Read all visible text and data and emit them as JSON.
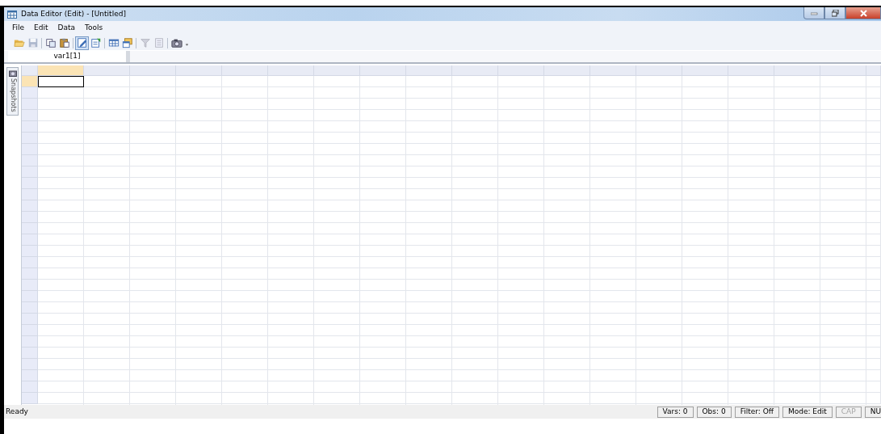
{
  "window": {
    "title": "Data Editor (Edit) - [Untitled]"
  },
  "menu": [
    {
      "label": "File"
    },
    {
      "label": "Edit"
    },
    {
      "label": "Data"
    },
    {
      "label": "Tools"
    }
  ],
  "toolbar": [
    {
      "kind": "open",
      "disabled": false,
      "pressed": false
    },
    {
      "kind": "save",
      "disabled": true,
      "pressed": false
    },
    {
      "kind": "separator"
    },
    {
      "kind": "copy",
      "disabled": false,
      "pressed": false
    },
    {
      "kind": "paste",
      "disabled": false,
      "pressed": false
    },
    {
      "kind": "separator"
    },
    {
      "kind": "edit",
      "disabled": false,
      "pressed": true
    },
    {
      "kind": "browse",
      "disabled": false,
      "pressed": false
    },
    {
      "kind": "separator"
    },
    {
      "kind": "table",
      "disabled": false,
      "pressed": false
    },
    {
      "kind": "properties",
      "disabled": false,
      "pressed": false
    },
    {
      "kind": "separator"
    },
    {
      "kind": "filter",
      "disabled": true,
      "pressed": false
    },
    {
      "kind": "clear",
      "disabled": true,
      "pressed": false
    },
    {
      "kind": "separator"
    },
    {
      "kind": "snapshot",
      "disabled": false,
      "pressed": false
    },
    {
      "kind": "overflow",
      "disabled": false,
      "pressed": false
    }
  ],
  "cell_reference": "var1[1]",
  "side_tab": {
    "label": "Snapshots"
  },
  "grid": {
    "columns": [
      {
        "selected": true
      },
      {
        "selected": false
      },
      {
        "selected": false
      },
      {
        "selected": false
      },
      {
        "selected": false
      },
      {
        "selected": false
      },
      {
        "selected": false
      },
      {
        "selected": false
      },
      {
        "selected": false
      },
      {
        "selected": false
      },
      {
        "selected": false
      },
      {
        "selected": false
      },
      {
        "selected": false
      },
      {
        "selected": false
      },
      {
        "selected": false
      },
      {
        "selected": false
      },
      {
        "selected": false
      },
      {
        "selected": false
      },
      {
        "selected": false
      }
    ],
    "rows": [
      {
        "selected": true
      },
      {
        "selected": false
      },
      {
        "selected": false
      },
      {
        "selected": false
      },
      {
        "selected": false
      },
      {
        "selected": false
      },
      {
        "selected": false
      },
      {
        "selected": false
      },
      {
        "selected": false
      },
      {
        "selected": false
      },
      {
        "selected": false
      },
      {
        "selected": false
      },
      {
        "selected": false
      },
      {
        "selected": false
      },
      {
        "selected": false
      },
      {
        "selected": false
      },
      {
        "selected": false
      },
      {
        "selected": false
      },
      {
        "selected": false
      },
      {
        "selected": false
      },
      {
        "selected": false
      },
      {
        "selected": false
      },
      {
        "selected": false
      },
      {
        "selected": false
      },
      {
        "selected": false
      },
      {
        "selected": false
      },
      {
        "selected": false
      },
      {
        "selected": false
      },
      {
        "selected": false
      }
    ]
  },
  "status_bar": {
    "message": "Ready",
    "panes": [
      {
        "text": "Vars: 0",
        "disabled": false
      },
      {
        "text": "Obs: 0",
        "disabled": false
      },
      {
        "text": "Filter: Off",
        "disabled": false
      },
      {
        "text": "Mode: Edit",
        "disabled": false
      },
      {
        "text": "CAP",
        "disabled": true
      },
      {
        "text": "NU",
        "disabled": false
      }
    ]
  }
}
